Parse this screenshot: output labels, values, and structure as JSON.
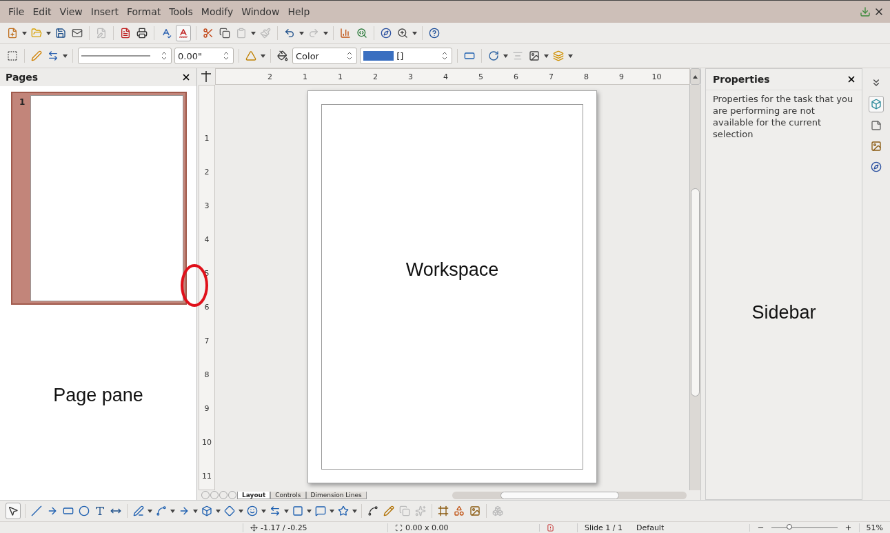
{
  "menu": [
    "File",
    "Edit",
    "View",
    "Insert",
    "Format",
    "Tools",
    "Modify",
    "Window",
    "Help"
  ],
  "line_toolbar": {
    "line_width": "0.00\"",
    "area_style": "Color",
    "area_color": "[]"
  },
  "page_pane": {
    "title": "Pages",
    "pages": [
      {
        "number": "1",
        "selected": true
      }
    ],
    "annotation": "Page pane"
  },
  "ruler": {
    "horizontal": [
      "2",
      "1",
      "1",
      "2",
      "3",
      "4",
      "5",
      "6",
      "7",
      "8",
      "9",
      "10"
    ],
    "vertical": [
      "1",
      "2",
      "3",
      "4",
      "5",
      "6",
      "7",
      "8",
      "9",
      "10",
      "11"
    ]
  },
  "workspace": {
    "annotation": "Workspace"
  },
  "sheet_tabs": [
    {
      "label": "Layout",
      "selected": true
    },
    {
      "label": "Controls",
      "selected": false
    },
    {
      "label": "Dimension Lines",
      "selected": false
    }
  ],
  "sidebar": {
    "title": "Properties",
    "message": "Properties for the task that you are performing are not available for the current selection",
    "annotation": "Sidebar"
  },
  "status_bar": {
    "position": "-1.17 / -0.25",
    "size": "0.00 x 0.00",
    "slide": "Slide 1 / 1",
    "layout": "Default",
    "zoom": "51%",
    "level": 0.28
  }
}
